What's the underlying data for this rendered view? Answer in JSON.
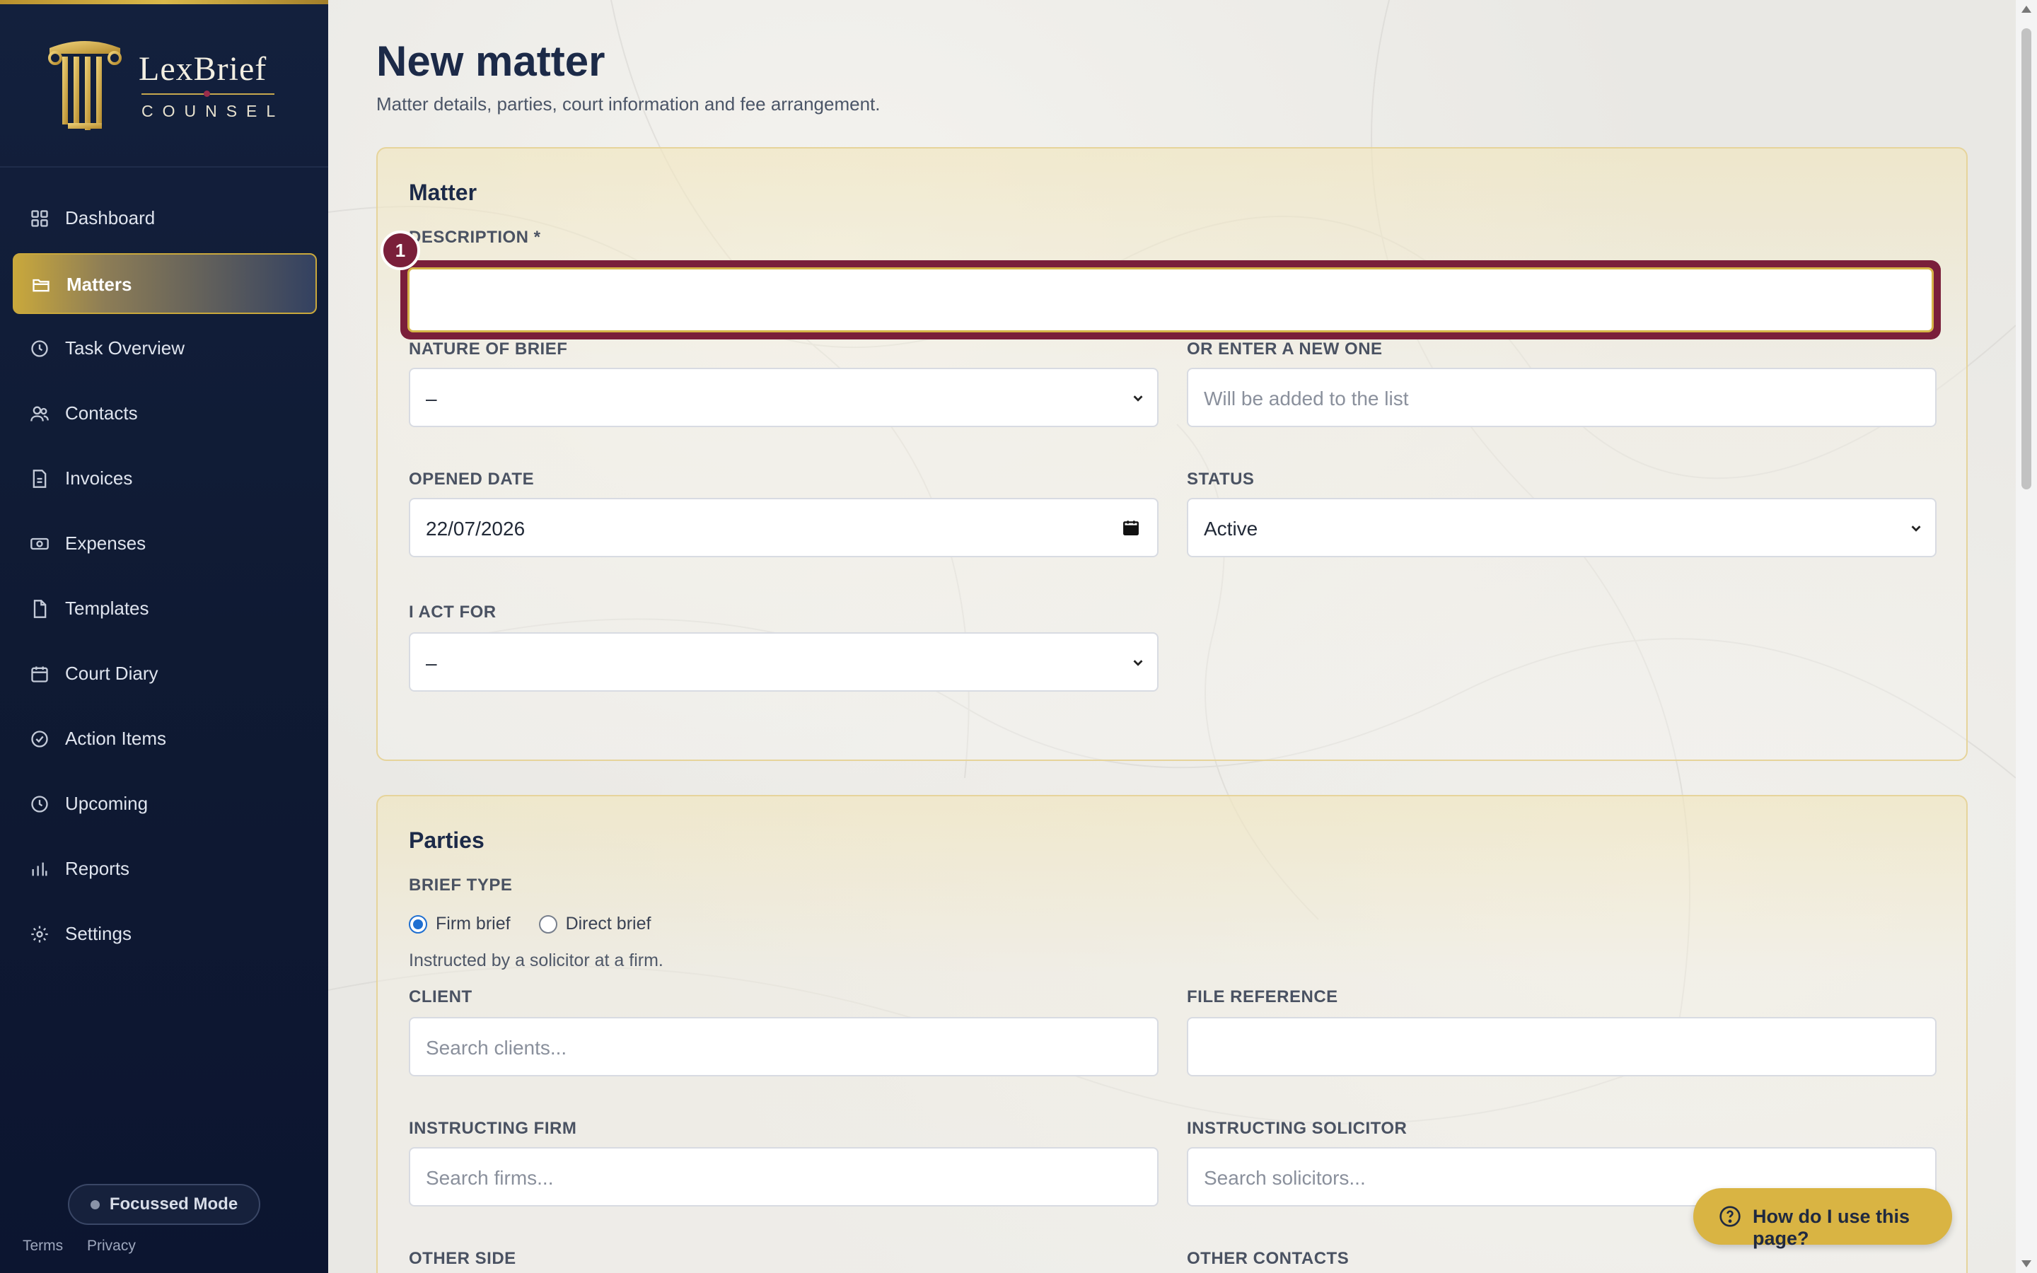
{
  "brand": {
    "name": "LexBrief",
    "tagline": "COUNSEL",
    "accent_gold": "#d9b443",
    "accent_burgundy": "#7a1f3a",
    "sidebar_bg": "#13203d"
  },
  "sidebar": {
    "items": [
      {
        "label": "Dashboard",
        "icon": "grid-icon"
      },
      {
        "label": "Matters",
        "icon": "folder-icon",
        "active": true
      },
      {
        "label": "Task Overview",
        "icon": "clock-icon"
      },
      {
        "label": "Contacts",
        "icon": "users-icon"
      },
      {
        "label": "Invoices",
        "icon": "invoice-icon"
      },
      {
        "label": "Expenses",
        "icon": "banknote-icon"
      },
      {
        "label": "Templates",
        "icon": "document-icon"
      },
      {
        "label": "Court Diary",
        "icon": "calendar-icon"
      },
      {
        "label": "Action Items",
        "icon": "check-circle-icon"
      },
      {
        "label": "Upcoming",
        "icon": "clock-icon"
      },
      {
        "label": "Reports",
        "icon": "bar-chart-icon"
      },
      {
        "label": "Settings",
        "icon": "gear-icon"
      }
    ],
    "focus_mode_label": "Focussed Mode",
    "footer": {
      "terms": "Terms",
      "privacy": "Privacy"
    }
  },
  "page": {
    "title": "New matter",
    "subtitle": "Matter details, parties, court information and fee arrangement."
  },
  "matter": {
    "title": "Matter",
    "description_label": "DESCRIPTION *",
    "description_value": "",
    "highlight_badge": "1",
    "nature_label": "NATURE OF BRIEF",
    "nature_value": "–",
    "new_nature_label": "OR ENTER A NEW ONE",
    "new_nature_placeholder": "Will be added to the list",
    "opened_label": "OPENED DATE",
    "opened_value": "22/07/2026",
    "status_label": "STATUS",
    "status_value": "Active",
    "act_for_label": "I ACT FOR",
    "act_for_value": "–"
  },
  "parties": {
    "title": "Parties",
    "brief_type_label": "BRIEF TYPE",
    "brief_options": [
      {
        "label": "Firm brief",
        "selected": true
      },
      {
        "label": "Direct brief",
        "selected": false
      }
    ],
    "brief_hint": "Instructed by a solicitor at a firm.",
    "client_label": "CLIENT",
    "client_placeholder": "Search clients...",
    "file_ref_label": "FILE REFERENCE",
    "file_ref_value": "",
    "firm_label": "INSTRUCTING FIRM",
    "firm_placeholder": "Search firms...",
    "solicitor_label": "INSTRUCTING SOLICITOR",
    "solicitor_placeholder": "Search solicitors...",
    "other_side_label": "OTHER SIDE",
    "other_contacts_label": "OTHER CONTACTS"
  },
  "help": {
    "label": "How do I use this page?",
    "icon": "question-circle-icon"
  }
}
